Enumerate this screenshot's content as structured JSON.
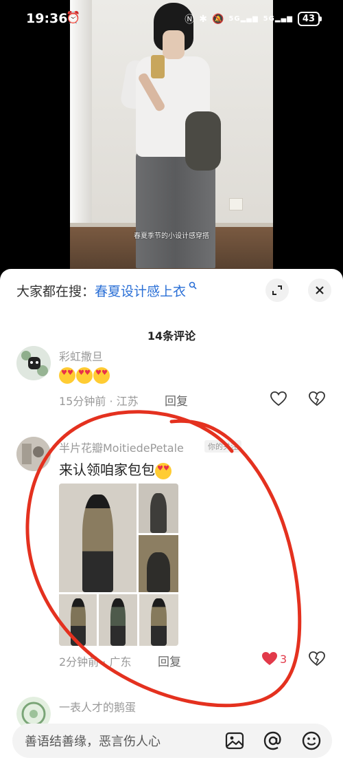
{
  "status_bar": {
    "time": "19:36",
    "network": "5G",
    "network2": "5G",
    "battery": "43"
  },
  "video": {
    "caption": "春夏季节的小设计感穿搭"
  },
  "sheet": {
    "search_prefix": "大家都在搜：",
    "search_term": "春夏设计感上衣",
    "comment_count_label": "14条评论"
  },
  "comments": [
    {
      "author": "彩虹撒旦",
      "time_location": "15分钟前 · 江苏",
      "reply_label": "回复"
    },
    {
      "author": "半片花瓣MoitiedePetale",
      "badge": "你的关注",
      "text": "来认领咱家包包",
      "time_location": "2分钟前 · 广东",
      "reply_label": "回复",
      "likes": "3"
    },
    {
      "author": "一表人才的鹅蛋"
    }
  ],
  "input": {
    "placeholder": "善语结善缘，恶言伤人心"
  },
  "colors": {
    "link": "#2a6fd6",
    "like": "#e23a4a",
    "annotation": "#e4311f"
  }
}
